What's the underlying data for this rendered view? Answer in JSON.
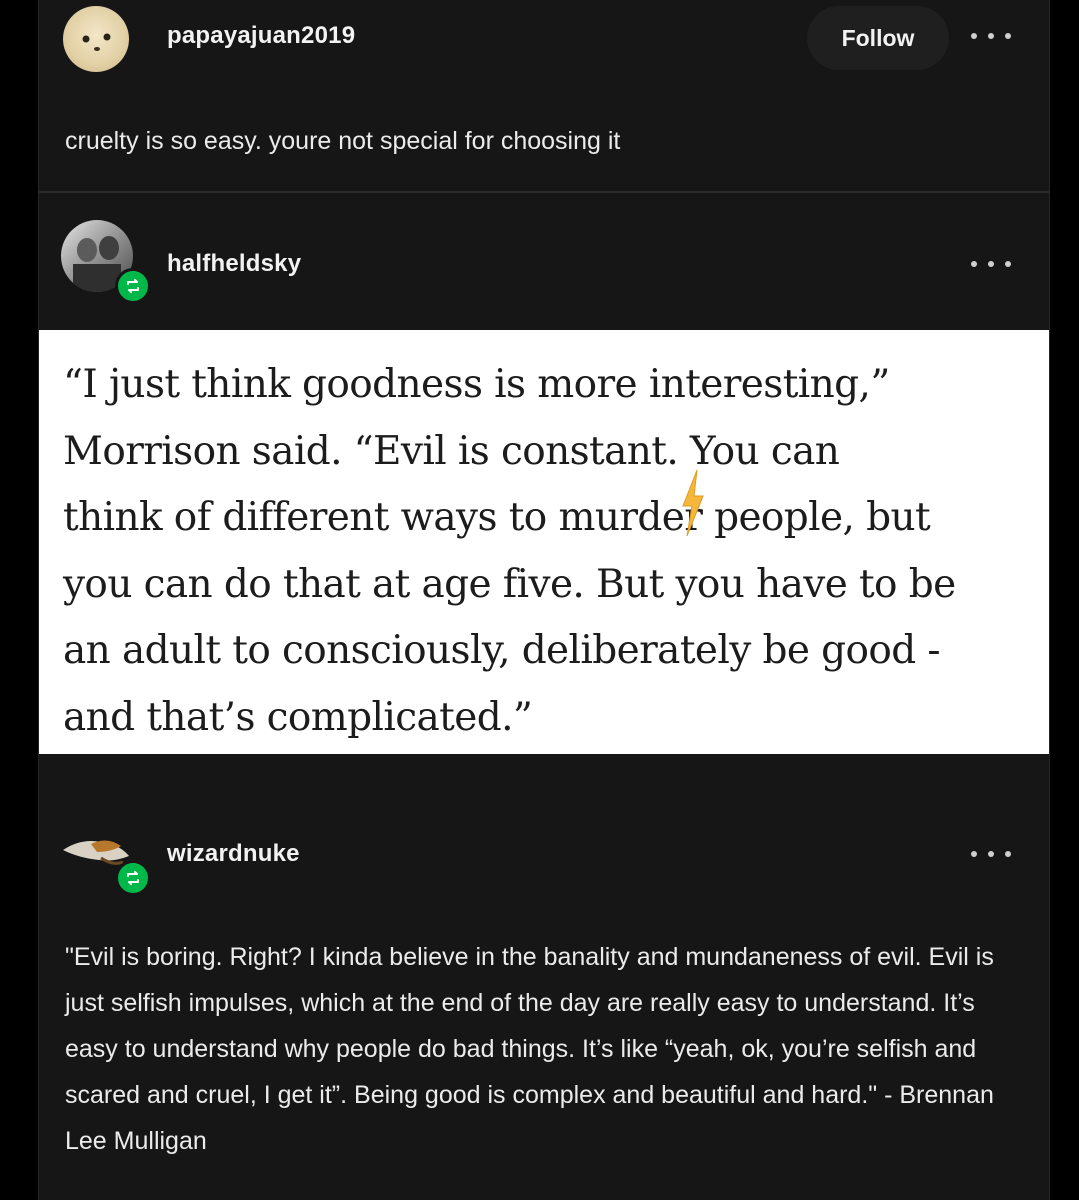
{
  "posts": [
    {
      "username": "papayajuan2019",
      "follow_label": "Follow",
      "body": "cruelty is so easy. youre not special for choosing it"
    },
    {
      "username": "halfheldsky",
      "quote": "“I just think goodness is more interesting,”\nMorrison said. “Evil is constant. You can\nthink of different ways to murder people, but\nyou can do that at age five. But you have to be\nan adult to consciously, deliberately be good -\nand that’s complicated.”"
    },
    {
      "username": "wizardnuke",
      "body": "\"Evil is boring. Right? I kinda believe in the banality and mundaneness of evil. Evil is just selfish impulses, which at the end of the day are really easy to understand. It’s easy to understand why people do bad things. It’s like “yeah, ok, you’re selfish and scared and cruel, I get it”. Being good is complex and beautiful and hard.\" - Brennan Lee Mulligan"
    }
  ],
  "icons": {
    "more": "more-horizontal-icon",
    "reblog": "reblog-icon"
  },
  "colors": {
    "background": "#161616",
    "text": "#ebebeb",
    "reblog_badge": "#00b84a",
    "quote_card": "#ffffff"
  }
}
